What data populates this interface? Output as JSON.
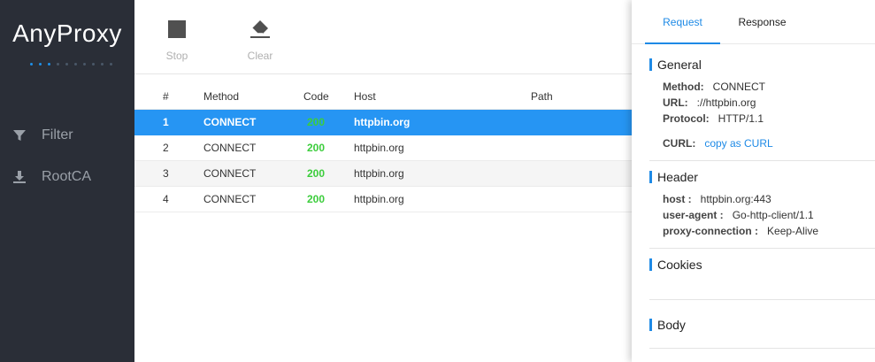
{
  "app": {
    "title": "AnyProxy"
  },
  "sidebar": {
    "items": [
      {
        "label": "Filter",
        "icon": "filter-icon"
      },
      {
        "label": "RootCA",
        "icon": "download-icon"
      }
    ]
  },
  "toolbar": {
    "stop_label": "Stop",
    "clear_label": "Clear"
  },
  "table": {
    "headers": {
      "num": "#",
      "method": "Method",
      "code": "Code",
      "host": "Host",
      "path": "Path"
    },
    "rows": [
      {
        "num": "1",
        "method": "CONNECT",
        "code": "200",
        "host": "httpbin.org",
        "path": ""
      },
      {
        "num": "2",
        "method": "CONNECT",
        "code": "200",
        "host": "httpbin.org",
        "path": ""
      },
      {
        "num": "3",
        "method": "CONNECT",
        "code": "200",
        "host": "httpbin.org",
        "path": ""
      },
      {
        "num": "4",
        "method": "CONNECT",
        "code": "200",
        "host": "httpbin.org",
        "path": ""
      }
    ]
  },
  "detail": {
    "tabs": {
      "request": "Request",
      "response": "Response"
    },
    "general": {
      "title": "General",
      "method_key": "Method:",
      "method_val": "CONNECT",
      "url_key": "URL:",
      "url_val": "://httpbin.org",
      "protocol_key": "Protocol:",
      "protocol_val": "HTTP/1.1",
      "curl_key": "CURL:",
      "curl_val": "copy as CURL"
    },
    "header": {
      "title": "Header",
      "items": [
        {
          "k": "host :",
          "v": "httpbin.org:443"
        },
        {
          "k": "user-agent :",
          "v": "Go-http-client/1.1"
        },
        {
          "k": "proxy-connection :",
          "v": "Keep-Alive"
        }
      ]
    },
    "cookies": {
      "title": "Cookies"
    },
    "body": {
      "title": "Body"
    }
  },
  "colors": {
    "accent": "#1e8ae6",
    "selected_row": "#2695f3",
    "status_ok": "#3ccd3c",
    "sidebar_bg": "#2a2e37"
  }
}
